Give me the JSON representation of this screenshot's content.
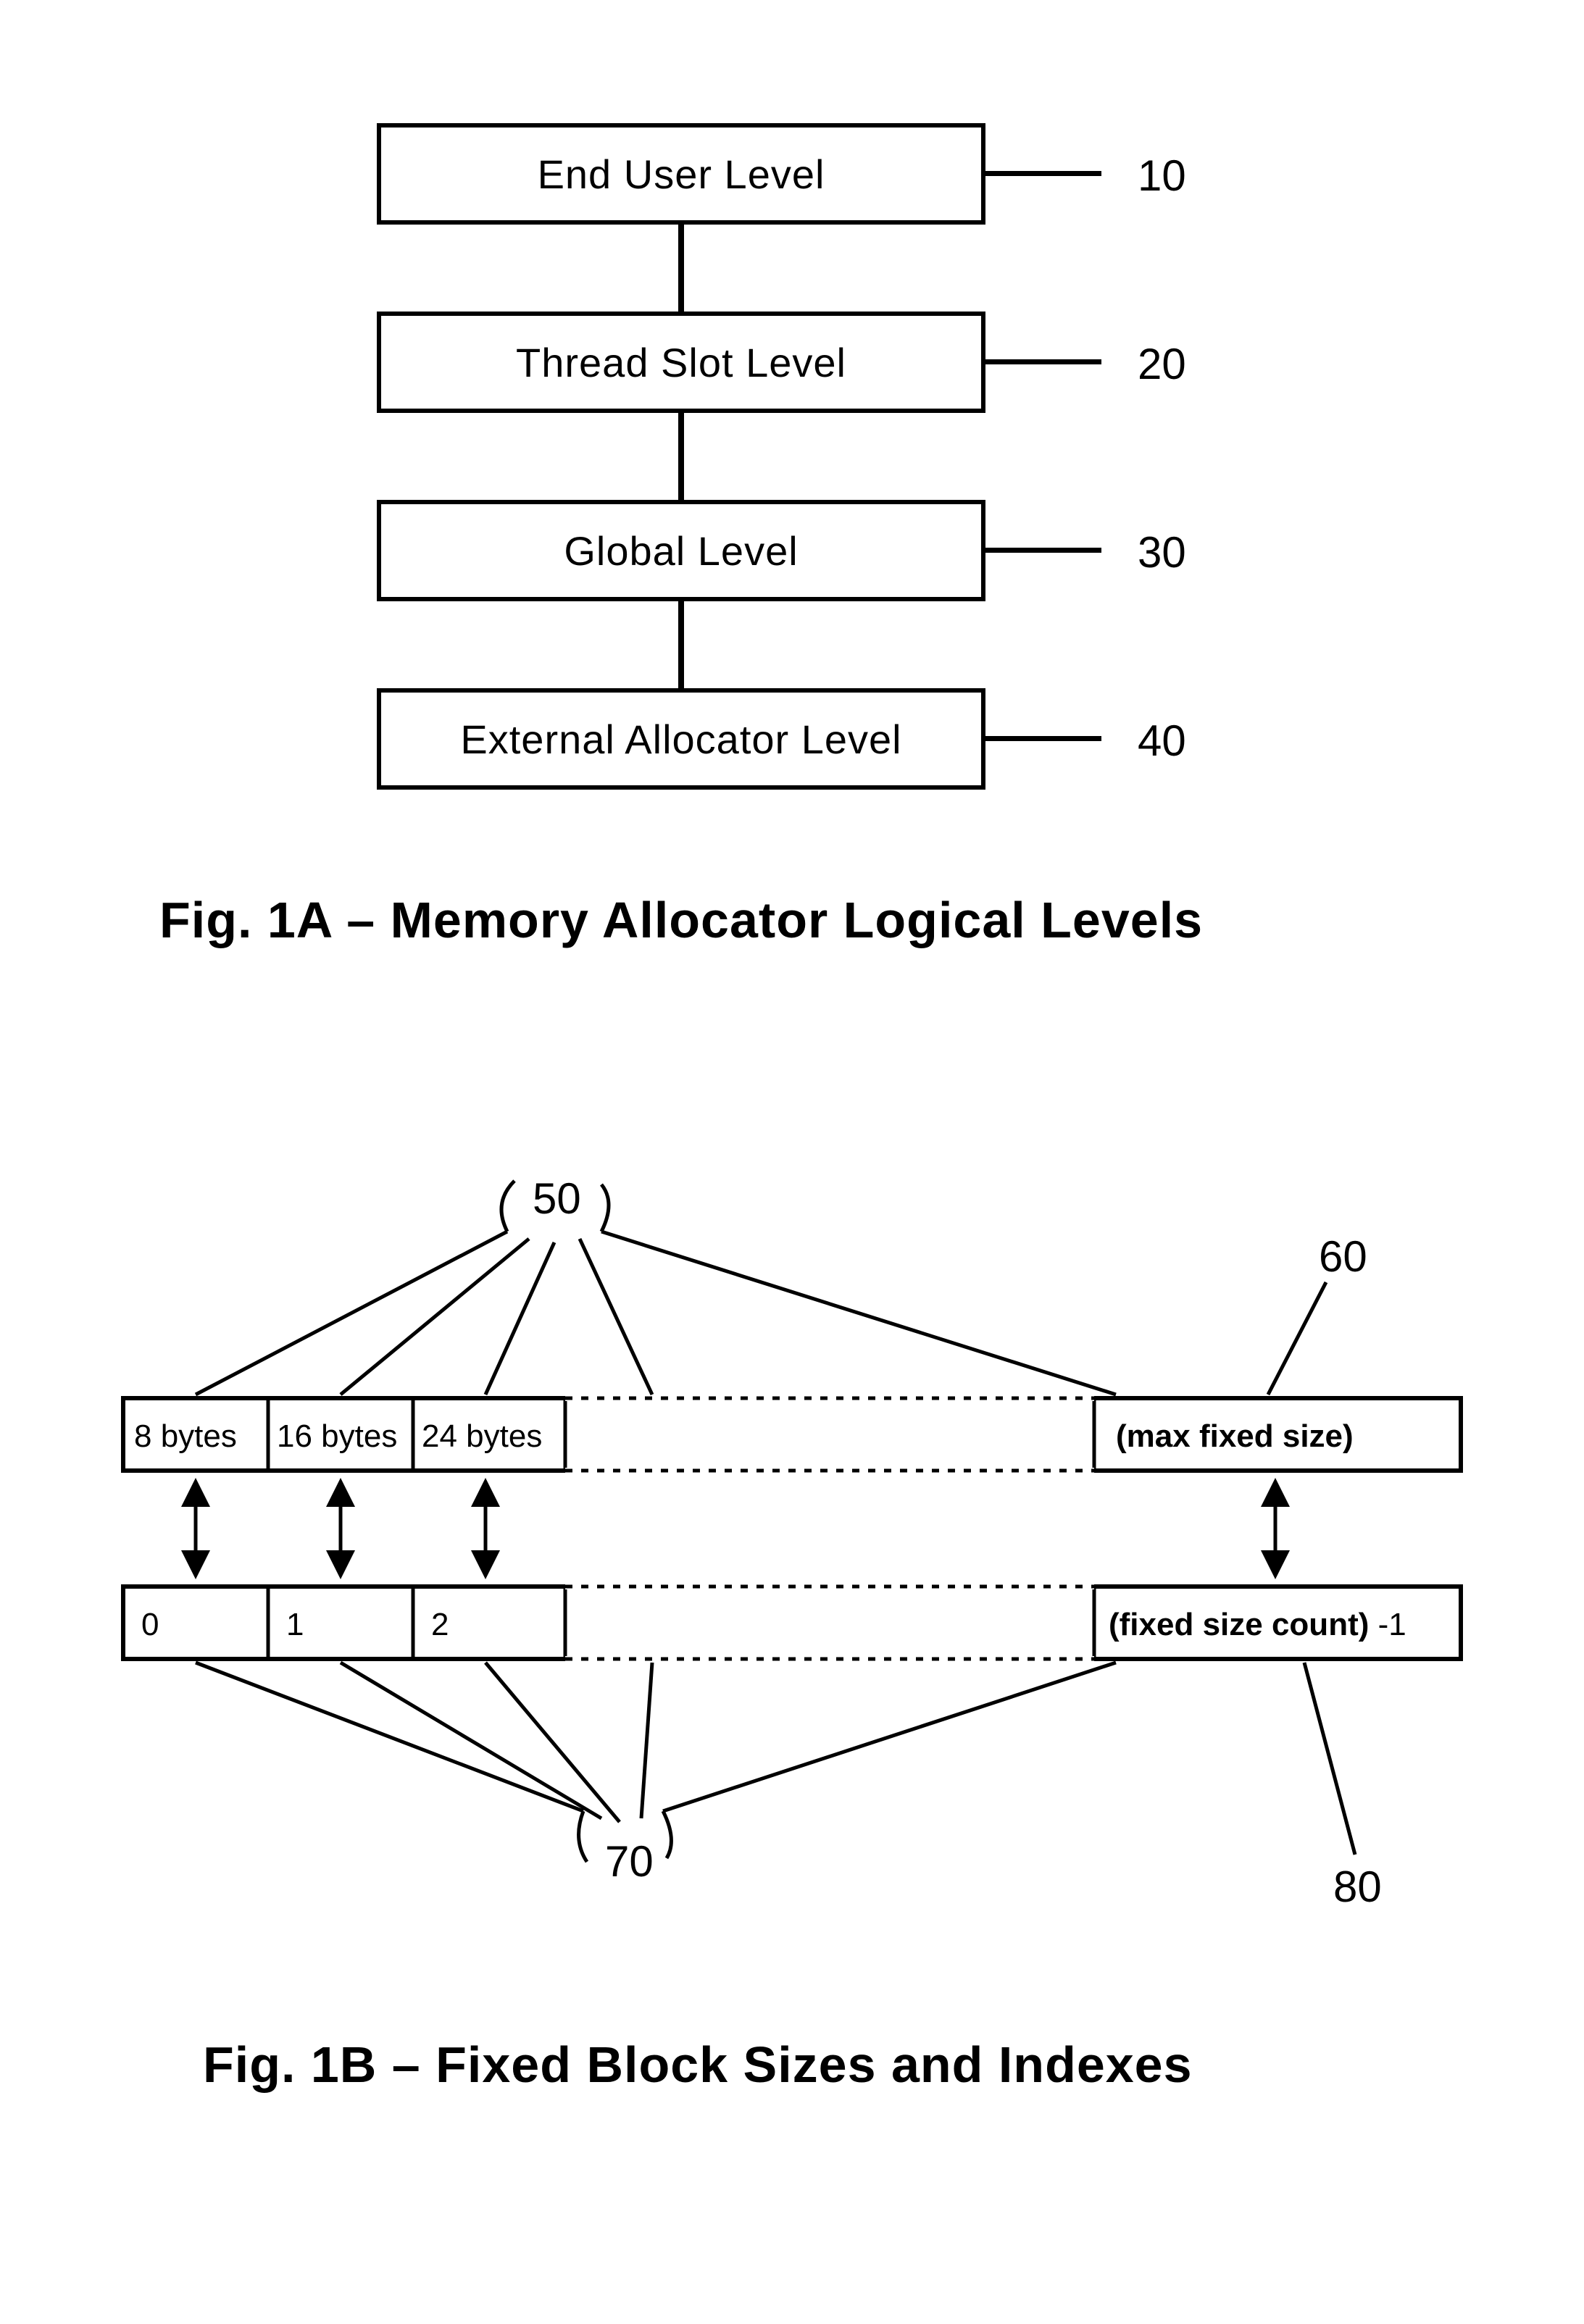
{
  "figA": {
    "levels": [
      {
        "label": "End User Level",
        "ref": "10"
      },
      {
        "label": "Thread Slot Level",
        "ref": "20"
      },
      {
        "label": "Global Level",
        "ref": "30"
      },
      {
        "label": "External Allocator Level",
        "ref": "40"
      }
    ],
    "caption": "Fig. 1A – Memory Allocator Logical Levels"
  },
  "figB": {
    "ref50": "50",
    "ref60": "60",
    "ref70": "70",
    "ref80": "80",
    "topCells": [
      "8 bytes",
      "16 bytes",
      "24 bytes"
    ],
    "topLastBold": "(max fixed size)",
    "bottomCells": [
      "0",
      "1",
      "2"
    ],
    "bottomLastBold": "(fixed size count)",
    "bottomLastSuffix": " -1",
    "caption": "Fig. 1B – Fixed Block Sizes and Indexes"
  }
}
